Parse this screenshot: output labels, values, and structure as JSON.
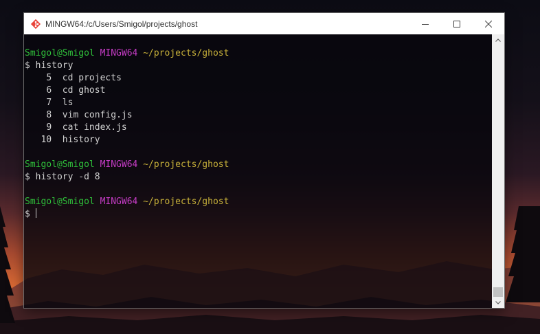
{
  "window": {
    "title": "MINGW64:/c/Users/Smigol/projects/ghost"
  },
  "prompt": {
    "user": "Smigol@Smigol",
    "env": "MINGW64",
    "path": "~/projects/ghost"
  },
  "terminal": {
    "commands": {
      "first": "$ history",
      "second": "$ history -d 8",
      "third": "$"
    },
    "history": [
      {
        "num": "5",
        "cmd": "cd projects"
      },
      {
        "num": "6",
        "cmd": "cd ghost"
      },
      {
        "num": "7",
        "cmd": "ls"
      },
      {
        "num": "8",
        "cmd": "vim config.js"
      },
      {
        "num": "9",
        "cmd": "cat index.js"
      },
      {
        "num": "10",
        "cmd": "history"
      }
    ]
  },
  "colors": {
    "user": "#2fbf3a",
    "env": "#c63cc6",
    "path": "#c8b13a",
    "text": "#d2d2d2"
  },
  "icons": {
    "app": "git-bash-diamond-icon",
    "minimize": "minimize-icon",
    "maximize": "maximize-icon",
    "close": "close-icon"
  }
}
